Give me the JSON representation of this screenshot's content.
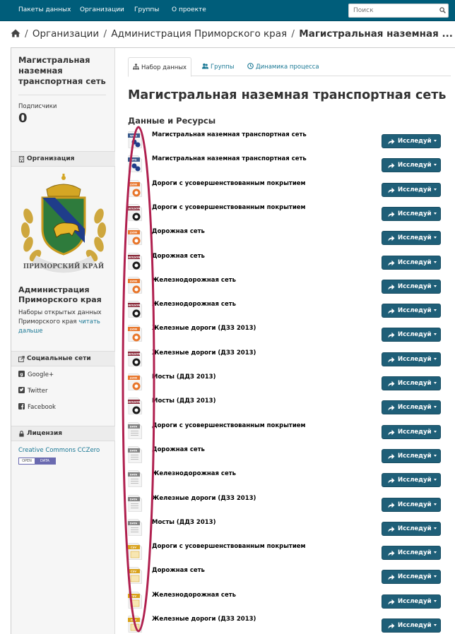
{
  "nav": {
    "items": [
      "Пакеты данных",
      "Организации",
      "Группы",
      "О проекте"
    ],
    "search_placeholder": "Поиск"
  },
  "breadcrumb": {
    "items": [
      "Организации",
      "Администрация Приморского края"
    ],
    "current": "Магистральная наземная ..."
  },
  "sidebar": {
    "dataset_title": "Магистральная наземная транспортная сеть",
    "followers_label": "Подписчики",
    "followers_count": "0",
    "org_heading": "Организация",
    "emblem_text": "ПРИМОРСКИЙ КРАЙ",
    "org_name": "Администрация Приморского края",
    "org_desc": "Наборы открытых данных Приморского края",
    "read_more": "читать дальше",
    "social_heading": "Социальные сети",
    "social": [
      "Google+",
      "Twitter",
      "Facebook"
    ],
    "license_heading": "Лицензия",
    "license_link": "Creative Commons CCZero",
    "badge_left": "OPEN",
    "badge_right": "DATA"
  },
  "tabs": [
    "Набор данных",
    "Группы",
    "Динамика процесса"
  ],
  "dataset": {
    "title": "Магистральная наземная транспортная сеть",
    "resources_heading": "Данные и Ресурсы",
    "explore_label": "Исследуй"
  },
  "format_colors": {
    "wms": "#3a5a8c",
    "wfs": "#3a5a8c",
    "json": "#e8762b",
    "geojson": "#8a2a3a",
    "data": "#808080",
    "csv": "#d9a21b"
  },
  "resources": [
    {
      "name": "Магистральная наземная транспортная сеть",
      "format": "WMS"
    },
    {
      "name": "Магистральная наземная транспортная сеть",
      "format": "WFS"
    },
    {
      "name": "Дороги с усовершенствованным покрытием",
      "format": "JSON"
    },
    {
      "name": "Дороги с усовершенствованным покрытием",
      "format": "geoJSON"
    },
    {
      "name": "Дорожная сеть",
      "format": "JSON"
    },
    {
      "name": "Дорожная сеть",
      "format": "geoJSON"
    },
    {
      "name": "Железнодорожная сеть",
      "format": "JSON"
    },
    {
      "name": "Железнодорожная сеть",
      "format": "geoJSON"
    },
    {
      "name": "Железные дороги (ДЗЗ 2013)",
      "format": "JSON"
    },
    {
      "name": "Железные дороги (ДЗЗ 2013)",
      "format": "geoJSON"
    },
    {
      "name": "Мосты (ДДЗ 2013)",
      "format": "JSON"
    },
    {
      "name": "Мосты (ДДЗ 2013)",
      "format": "geoJSON"
    },
    {
      "name": "Дороги с усовершенствованным покрытием",
      "format": "DATA"
    },
    {
      "name": "Дорожная сеть",
      "format": "DATA"
    },
    {
      "name": "Железнодорожная сеть",
      "format": "DATA"
    },
    {
      "name": "Железные дороги (ДЗЗ 2013)",
      "format": "DATA"
    },
    {
      "name": "Мосты (ДДЗ 2013)",
      "format": "DATA"
    },
    {
      "name": "Дороги с усовершенствованным покрытием",
      "format": "CSV"
    },
    {
      "name": "Дорожная сеть",
      "format": "CSV"
    },
    {
      "name": "Железнодорожная сеть",
      "format": "CSV"
    },
    {
      "name": "Железные дороги (ДЗЗ 2013)",
      "format": "CSV"
    }
  ]
}
